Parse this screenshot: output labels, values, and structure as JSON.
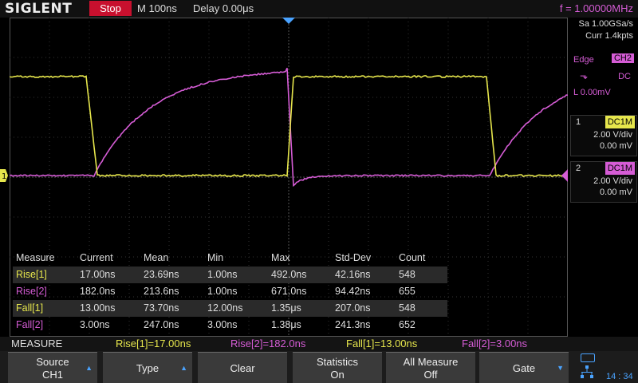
{
  "header": {
    "brand": "SIGLENT",
    "run_state": "Stop",
    "timebase": "M 100ns",
    "delay": "Delay 0.00μs",
    "frequency": "f = 1.00000MHz"
  },
  "acquisition": {
    "sample_rate": "Sa 1.00GSa/s",
    "memory": "Curr 1.4kpts"
  },
  "trigger": {
    "type": "Edge",
    "source": "CH2",
    "coupling": "DC",
    "slope_icon": "falling-edge-icon",
    "level": "L  0.00mV"
  },
  "channels": [
    {
      "num": "1",
      "coupling": "DC1M",
      "scale": "2.00 V/div",
      "offset": "0.00 mV",
      "color": "#e6e64c"
    },
    {
      "num": "2",
      "coupling": "DC1M",
      "scale": "2.00 V/div",
      "offset": "0.00 mV",
      "color": "#d55cd5"
    }
  ],
  "measurements": {
    "headers": [
      "Measure",
      "Current",
      "Mean",
      "Min",
      "Max",
      "Std-Dev",
      "Count"
    ],
    "rows": [
      {
        "name": "Rise[1]",
        "color": "#e6e64c",
        "values": [
          "17.00ns",
          "23.69ns",
          "1.00ns",
          "492.0ns",
          "42.16ns",
          "548"
        ]
      },
      {
        "name": "Rise[2]",
        "color": "#d55cd5",
        "values": [
          "182.0ns",
          "213.6ns",
          "1.00ns",
          "671.0ns",
          "94.42ns",
          "655"
        ]
      },
      {
        "name": "Fall[1]",
        "color": "#e6e64c",
        "values": [
          "13.00ns",
          "73.70ns",
          "12.00ns",
          "1.35μs",
          "207.0ns",
          "548"
        ]
      },
      {
        "name": "Fall[2]",
        "color": "#d55cd5",
        "values": [
          "3.00ns",
          "247.0ns",
          "3.00ns",
          "1.38μs",
          "241.3ns",
          "652"
        ]
      }
    ]
  },
  "measure_bar": {
    "title": "MEASURE",
    "items": [
      {
        "text": "Rise[1]=17.00ns",
        "color": "#e6e64c"
      },
      {
        "text": "Rise[2]=182.0ns",
        "color": "#d55cd5"
      },
      {
        "text": "Fall[1]=13.00ns",
        "color": "#e6e64c"
      },
      {
        "text": "Fall[2]=3.00ns",
        "color": "#d55cd5"
      }
    ]
  },
  "softkeys": [
    {
      "line1": "Source",
      "line2": "CH1",
      "has_arrow": true
    },
    {
      "line1": "Type",
      "line2": "",
      "has_arrow": true
    },
    {
      "line1": "Clear",
      "line2": "",
      "has_arrow": false
    },
    {
      "line1": "Statistics",
      "line2": "On",
      "has_arrow": false
    },
    {
      "line1": "All Measure",
      "line2": "Off",
      "has_arrow": false
    },
    {
      "line1": "Gate",
      "line2": "",
      "has_arrow": true
    }
  ],
  "status": {
    "clock": "14 : 34"
  },
  "colors": {
    "ch1": "#e6e64c",
    "ch2": "#d55cd5",
    "accent": "#4aa3ff",
    "stop": "#c8102e"
  }
}
